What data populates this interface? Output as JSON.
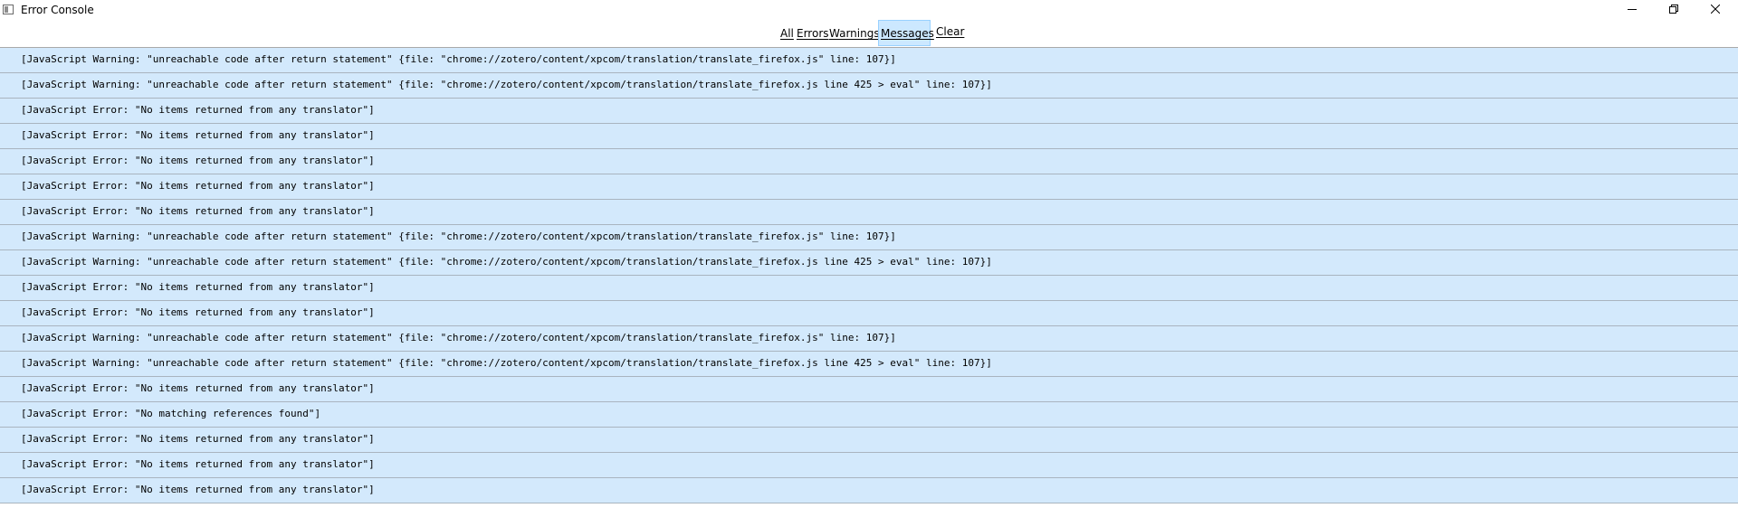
{
  "window": {
    "title": "Error Console",
    "controls": [
      "minimize-icon",
      "restore-icon",
      "close-icon"
    ]
  },
  "toolbar": {
    "filters": [
      {
        "label": "All",
        "selected": false
      },
      {
        "label": "Errors",
        "selected": false
      },
      {
        "label": "Warnings",
        "selected": false
      },
      {
        "label": "Messages",
        "selected": true
      }
    ],
    "clear_label": "Clear"
  },
  "colors": {
    "row_background": "#d3e9fc",
    "row_separator": "#a9b4bf",
    "selected_filter_background": "#cce8ff"
  },
  "messages": [
    "[JavaScript Warning: \"unreachable code after return statement\" {file: \"chrome://zotero/content/xpcom/translation/translate_firefox.js\" line: 107}]",
    "[JavaScript Warning: \"unreachable code after return statement\" {file: \"chrome://zotero/content/xpcom/translation/translate_firefox.js line 425 > eval\" line: 107}]",
    "[JavaScript Error: \"No items returned from any translator\"]",
    "[JavaScript Error: \"No items returned from any translator\"]",
    "[JavaScript Error: \"No items returned from any translator\"]",
    "[JavaScript Error: \"No items returned from any translator\"]",
    "[JavaScript Error: \"No items returned from any translator\"]",
    "[JavaScript Warning: \"unreachable code after return statement\" {file: \"chrome://zotero/content/xpcom/translation/translate_firefox.js\" line: 107}]",
    "[JavaScript Warning: \"unreachable code after return statement\" {file: \"chrome://zotero/content/xpcom/translation/translate_firefox.js line 425 > eval\" line: 107}]",
    "[JavaScript Error: \"No items returned from any translator\"]",
    "[JavaScript Error: \"No items returned from any translator\"]",
    "[JavaScript Warning: \"unreachable code after return statement\" {file: \"chrome://zotero/content/xpcom/translation/translate_firefox.js\" line: 107}]",
    "[JavaScript Warning: \"unreachable code after return statement\" {file: \"chrome://zotero/content/xpcom/translation/translate_firefox.js line 425 > eval\" line: 107}]",
    "[JavaScript Error: \"No items returned from any translator\"]",
    "[JavaScript Error: \"No matching references found\"]",
    "[JavaScript Error: \"No items returned from any translator\"]",
    "[JavaScript Error: \"No items returned from any translator\"]",
    "[JavaScript Error: \"No items returned from any translator\"]"
  ]
}
